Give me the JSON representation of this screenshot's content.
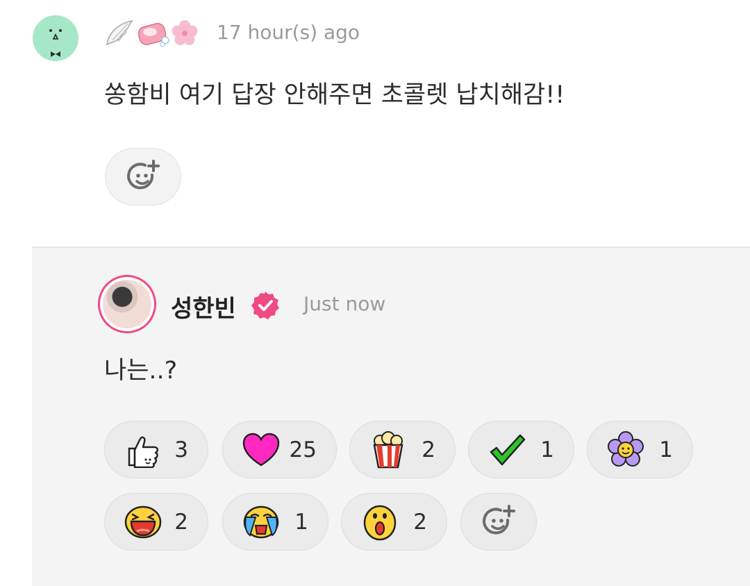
{
  "comment": {
    "time": "17 hour(s) ago",
    "text": "쏭함비 여기 답장 안해주면 초콜렛 납치해감!!",
    "badges": [
      "angel-wing-icon",
      "soap-icon",
      "cherry-blossom-icon"
    ]
  },
  "reply": {
    "author": "성한빈",
    "time": "Just now",
    "text": "나는..?",
    "accent": "#f04a82",
    "reactions": [
      {
        "icon": "thumbs-up-icon",
        "count": "3"
      },
      {
        "icon": "heart-icon",
        "count": "25"
      },
      {
        "icon": "popcorn-icon",
        "count": "2"
      },
      {
        "icon": "check-icon",
        "count": "1"
      },
      {
        "icon": "flower-icon",
        "count": "1"
      },
      {
        "icon": "laughing-face-icon",
        "count": "2"
      },
      {
        "icon": "crying-face-icon",
        "count": "1"
      },
      {
        "icon": "shocked-face-icon",
        "count": "2"
      }
    ]
  }
}
